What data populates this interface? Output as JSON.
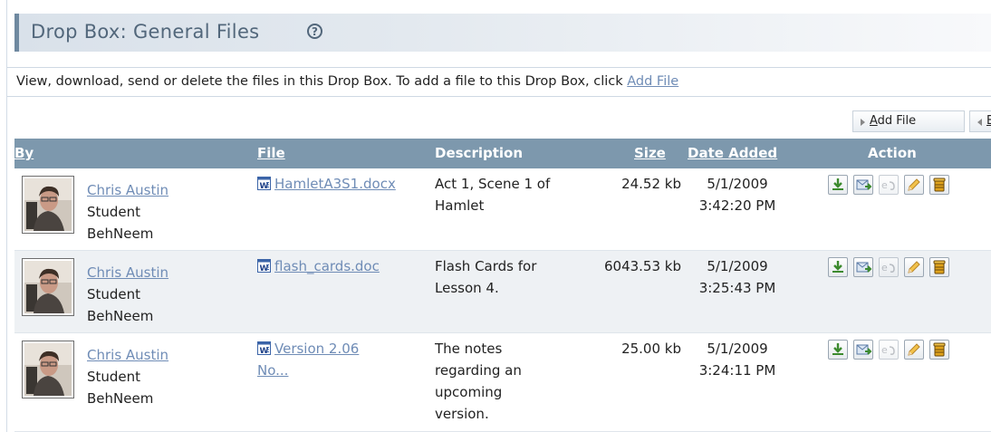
{
  "page": {
    "title": "Drop Box: General Files",
    "help_glyph": "?",
    "description_text": "View, download, send or delete the files in this Drop Box. To add a file to this Drop Box, click ",
    "description_link": "Add File"
  },
  "toolbar": {
    "add_file_label": "Add File",
    "back_label": "Back"
  },
  "table": {
    "headers": {
      "by": "By",
      "file": "File",
      "description": "Description",
      "size": "Size",
      "date_added": "Date Added",
      "action": "Action"
    },
    "rows": [
      {
        "author": "Chris Austin",
        "role": "Student",
        "group": "BehNeem",
        "file": "HamletA3S1.docx",
        "file_line2": "",
        "description_lines": [
          "Act 1, Scene 1 of",
          "Hamlet"
        ],
        "size": "24.52 kb",
        "date": "5/1/2009",
        "time": "3:42:20 PM"
      },
      {
        "author": "Chris Austin",
        "role": "Student",
        "group": "BehNeem",
        "file": "flash_cards.doc",
        "file_line2": "",
        "description_lines": [
          "Flash Cards for",
          "Lesson 4."
        ],
        "size": "6043.53 kb",
        "date": "5/1/2009",
        "time": "3:25:43 PM"
      },
      {
        "author": "Chris Austin",
        "role": "Student",
        "group": "BehNeem",
        "file": "Version 2.06",
        "file_line2": "No...",
        "description_lines": [
          "The notes",
          "regarding an",
          "upcoming",
          "version."
        ],
        "size": "25.00 kb",
        "date": "5/1/2009",
        "time": "3:24:11 PM"
      }
    ],
    "action_icons": [
      "download-icon",
      "send-icon",
      "email-disabled-icon",
      "edit-pencil-icon",
      "delete-bin-icon"
    ]
  },
  "colors": {
    "header_bg": "#7d98ad",
    "link": "#6f8cb6",
    "title_text": "#52677b",
    "row_alt": "#eef1f4"
  }
}
